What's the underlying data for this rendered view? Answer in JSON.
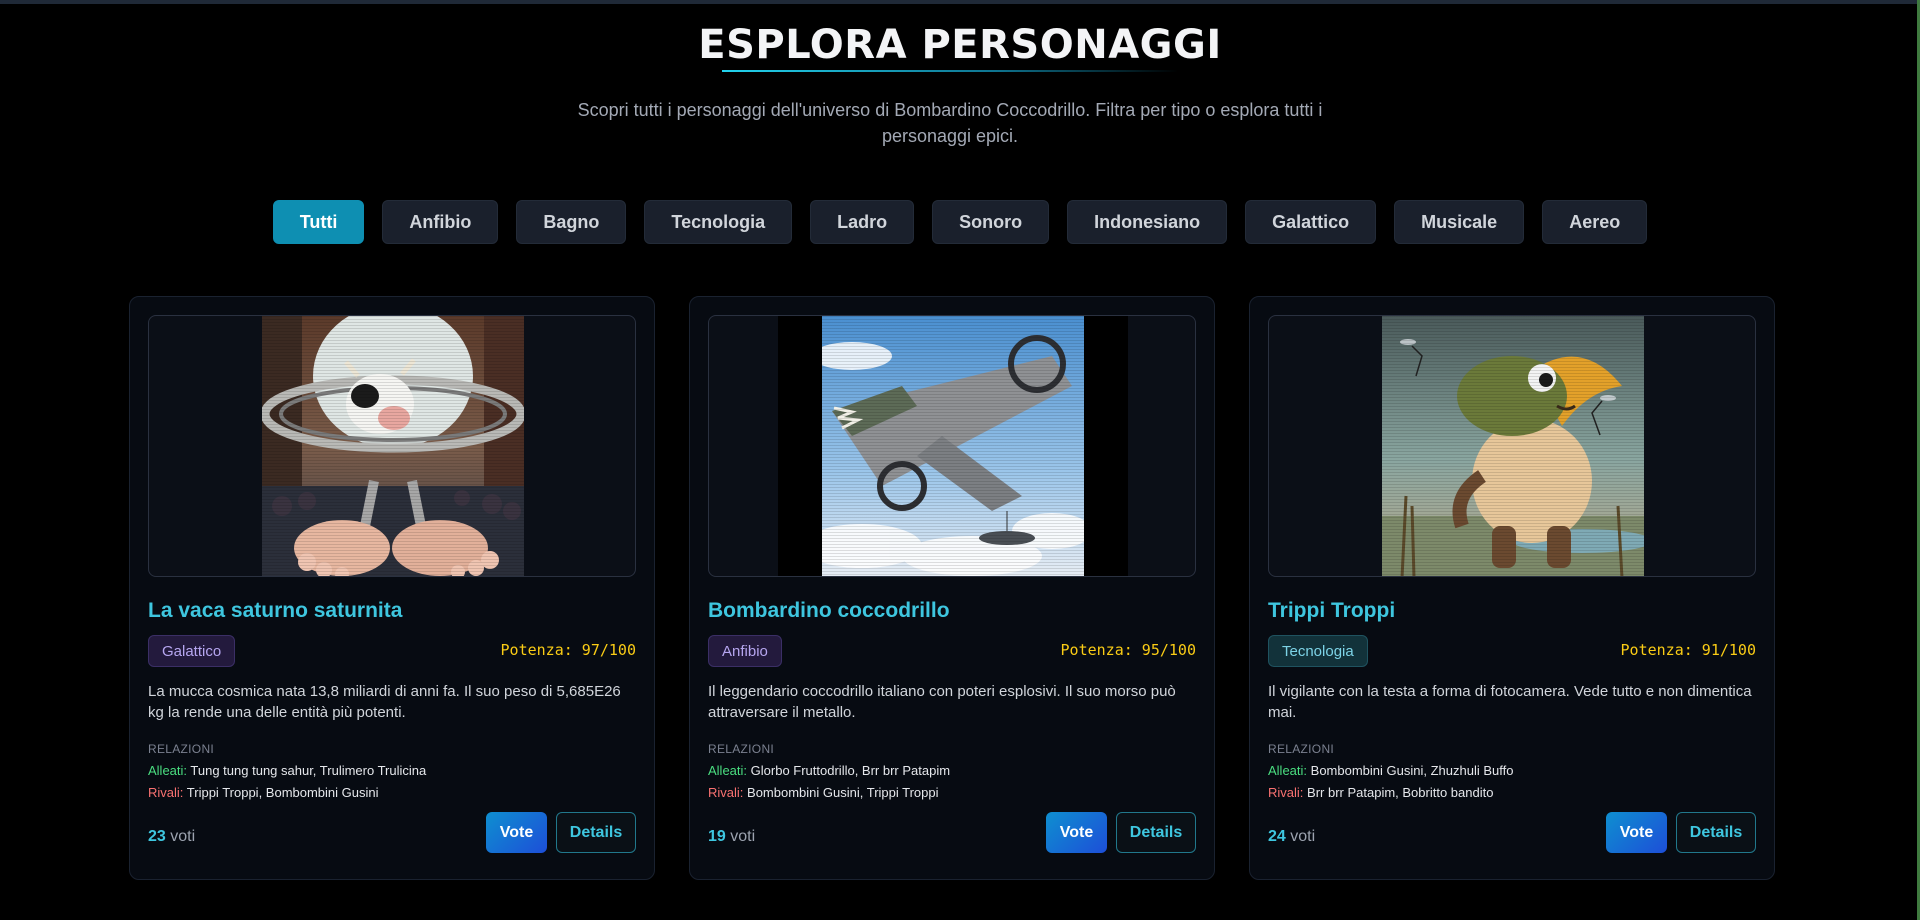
{
  "header": {
    "title": "ESPLORA PERSONAGGI",
    "subtitle": "Scopri tutti i personaggi dell'universo di Bombardino Coccodrillo. Filtra per tipo o esplora tutti i personaggi epici."
  },
  "filters": {
    "active": "Tutti",
    "items": [
      "Tutti",
      "Anfibio",
      "Bagno",
      "Tecnologia",
      "Ladro",
      "Sonoro",
      "Indonesiano",
      "Galattico",
      "Musicale",
      "Aereo"
    ]
  },
  "labels": {
    "relations": "RELAZIONI",
    "allies": "Alleati:",
    "rivals": "Rivali:",
    "votes_suffix": "voti",
    "vote_button": "Vote",
    "details_button": "Details"
  },
  "cards": [
    {
      "name": "La vaca saturno saturnita",
      "type": "Galattico",
      "power": "Potenza: 97/100",
      "description": "La mucca cosmica nata 13,8 miliardi di anni fa. Il suo peso di 5,685E26 kg la rende una delle entità più potenti.",
      "allies": "Tung tung tung sahur, Trulimero Trulicina",
      "rivals": "Trippi Troppi, Bombombini Gusini",
      "votes": "23"
    },
    {
      "name": "Bombardino coccodrillo",
      "type": "Anfibio",
      "power": "Potenza: 95/100",
      "description": "Il leggendario coccodrillo italiano con poteri esplosivi. Il suo morso può attraversare il metallo.",
      "allies": "Glorbo Fruttodrillo, Brr brr Patapim",
      "rivals": "Bombombini Gusini, Trippi Troppi",
      "votes": "19"
    },
    {
      "name": "Trippi Troppi",
      "type": "Tecnologia",
      "power": "Potenza: 91/100",
      "description": "Il vigilante con la testa a forma di fotocamera. Vede tutto e non dimentica mai.",
      "allies": "Bombombini Gusini, Zhuzhuli Buffo",
      "rivals": "Brr brr Patapim, Bobritto bandito",
      "votes": "24"
    }
  ],
  "colors": {
    "accent": "#0e8fb2",
    "title_accent": "#3ec6df",
    "power": "#facc15",
    "allies": "#4ade80",
    "rivals": "#f87171"
  }
}
